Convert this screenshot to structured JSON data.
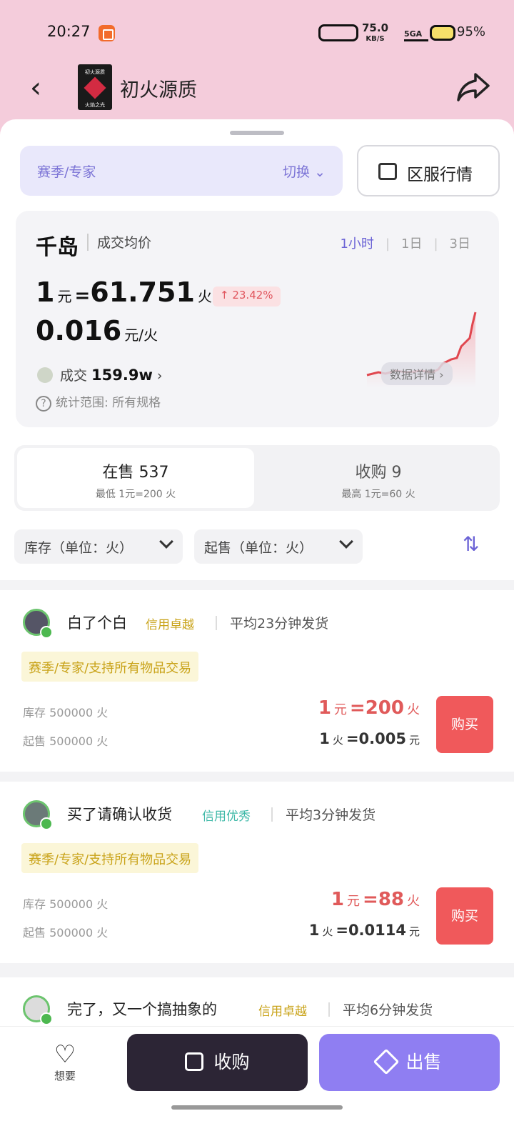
{
  "status_bar": {
    "time": "20:27",
    "net_speed": "75.0",
    "net_unit": "KB/S",
    "signal": "5GA",
    "battery": "95%"
  },
  "header": {
    "app_name": "初火源质",
    "logo_top": "初火源质",
    "logo_bottom": "火焰之光"
  },
  "server": {
    "name": "赛季/专家",
    "switch_label": "切换",
    "market_label": "区服行情"
  },
  "price_card": {
    "brand": "千岛",
    "avg_label": "成交均价",
    "periods": [
      "1小时",
      "1日",
      "3日"
    ],
    "rate_prefix": "1",
    "rate_unit_yuan": "元",
    "eq": "=",
    "rate_value": "61.751",
    "rate_unit_huo": "火",
    "change": "↑ 23.42%",
    "rate2_value": "0.016",
    "rate2_unit": "元/火",
    "volume_label": "成交",
    "volume_value": "159.9w",
    "volume_arrow": "›",
    "scope": "统计范围: 所有规格",
    "detail_chip": "数据详情 ›"
  },
  "tabs": {
    "sell": {
      "title": "在售 537",
      "sub": "最低 1元=200 火"
    },
    "buy": {
      "title": "收购 9",
      "sub": "最高 1元=60 火"
    }
  },
  "filters": {
    "stock": "库存（单位：火）",
    "min_sell": "起售（单位：火）",
    "sort_icon": "⇅"
  },
  "listings": [
    {
      "seller": "白了个白",
      "credit": "信用卓越",
      "ship": "平均23分钟发货",
      "tag": "赛季/专家/支持所有物品交易",
      "stock": "库存 500000 火",
      "min_sell": "起售 500000 火",
      "p1_num": "1",
      "p1_u1": "元",
      "p1_eq": "=",
      "p1_val": "200",
      "p1_u2": "火",
      "p2_num": "1",
      "p2_u1": "火",
      "p2_eq": "=",
      "p2_val": "0.005",
      "p2_u2": "元",
      "buy_label": "购买"
    },
    {
      "seller": "买了请确认收货",
      "credit": "信用优秀",
      "ship": "平均3分钟发货",
      "tag": "赛季/专家/支持所有物品交易",
      "stock": "库存 500000 火",
      "min_sell": "起售 500000 火",
      "p1_num": "1",
      "p1_u1": "元",
      "p1_eq": "=",
      "p1_val": "88",
      "p1_u2": "火",
      "p2_num": "1",
      "p2_u1": "火",
      "p2_eq": "=",
      "p2_val": "0.0114",
      "p2_u2": "元",
      "buy_label": "购买"
    },
    {
      "seller": "完了，又一个搞抽象的",
      "credit": "信用卓越",
      "ship": "平均6分钟发货"
    }
  ],
  "bottom": {
    "fav_label": "想要",
    "buy_label": "收购",
    "sell_label": "出售"
  },
  "colors": {
    "accent": "#8f7ef2",
    "price_red": "#e05a5a",
    "buy_btn": "#f0595b",
    "credit_gold": "#c9a319",
    "credit_teal": "#3fb9a8",
    "header_bg": "#f4ccdb"
  }
}
